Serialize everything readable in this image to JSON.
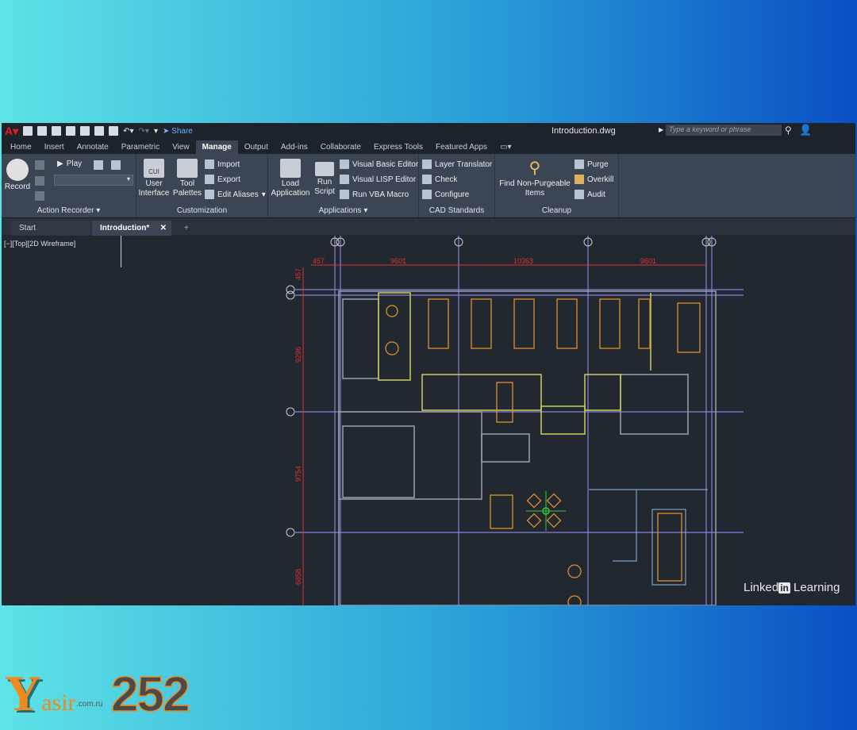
{
  "titlebar": {
    "share": "Share",
    "document": "Introduction.dwg",
    "search_placeholder": "Type a keyword or phrase"
  },
  "tabs": [
    "Home",
    "Insert",
    "Annotate",
    "Parametric",
    "View",
    "Manage",
    "Output",
    "Add-ins",
    "Collaborate",
    "Express Tools",
    "Featured Apps"
  ],
  "active_tab": "Manage",
  "ribbon": {
    "action_recorder": {
      "title": "Action Recorder",
      "record": "Record",
      "play": "Play"
    },
    "customization": {
      "title": "Customization",
      "user_interface": "User Interface",
      "tool_palettes": "Tool Palettes",
      "import": "Import",
      "export": "Export",
      "edit_aliases": "Edit Aliases",
      "cui": "CUI"
    },
    "applications": {
      "title": "Applications",
      "load_application": "Load Application",
      "run_script": "Run Script",
      "vba_editor": "Visual Basic Editor",
      "lisp_editor": "Visual LISP Editor",
      "run_vba": "Run VBA Macro"
    },
    "cad_standards": {
      "title": "CAD Standards",
      "layer_translator": "Layer Translator",
      "check": "Check",
      "configure": "Configure"
    },
    "cleanup": {
      "title": "Cleanup",
      "find": "Find Non-Purgeable Items",
      "purge": "Purge",
      "overkill": "Overkill",
      "audit": "Audit"
    }
  },
  "file_tabs": {
    "start": "Start",
    "current": "Introduction*"
  },
  "viewport": {
    "label": "[−][Top][2D Wireframe]"
  },
  "drawing": {
    "dims_top": [
      "457",
      "9601",
      "10363",
      "9601"
    ],
    "dims_left": [
      "457",
      "9296",
      "9754",
      "6858"
    ]
  },
  "watermark": "Linked in Learning",
  "watermark_parts": {
    "a": "Linked",
    "b": "in",
    "c": "Learning"
  },
  "brand": {
    "name": "Yasir",
    "domain": ".com.ru",
    "number": "252"
  }
}
